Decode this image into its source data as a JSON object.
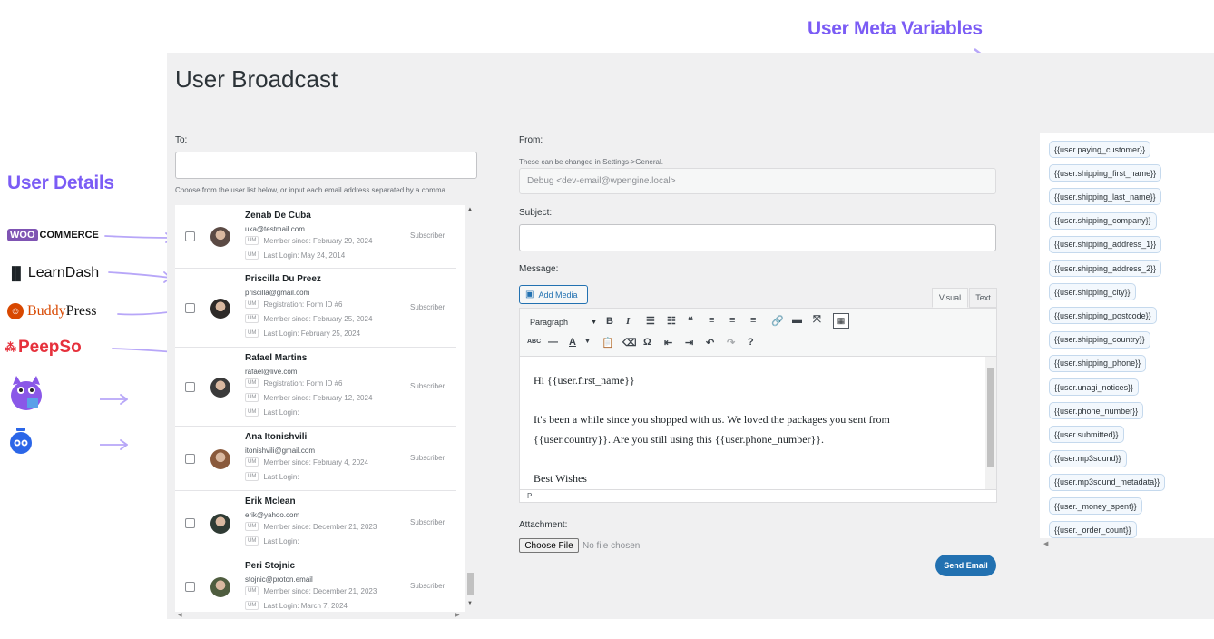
{
  "callouts": {
    "user_details": "User Details",
    "user_meta_variables": "User Meta Variables"
  },
  "integrations": [
    {
      "name": "woocommerce",
      "label": "COMMERCE",
      "badge": "WOO"
    },
    {
      "name": "learndash",
      "label": "LearnDash"
    },
    {
      "name": "buddypress",
      "label": "BuddyPress",
      "prefix": "Buddy",
      "suffix": "Press"
    },
    {
      "name": "peepso",
      "label": "PeepSo"
    },
    {
      "name": "mascot",
      "label": ""
    },
    {
      "name": "clock-logo",
      "label": ""
    }
  ],
  "page": {
    "title": "User Broadcast"
  },
  "to": {
    "label": "To:",
    "value": "",
    "help": "Choose from the user list below, or input each email address separated by a comma."
  },
  "users": [
    {
      "name": "Zenab De Cuba",
      "email": "uka@testmail.com",
      "meta": [
        "Member since: February 29, 2024",
        "Last Login: May 24, 2014"
      ],
      "role": "Subscriber",
      "avatar_color": "#5b4a44"
    },
    {
      "name": "Priscilla Du Preez",
      "email": "priscilla@gmail.com",
      "meta": [
        "Registration: Form ID #6",
        "Member since: February 25, 2024",
        "Last Login: February 25, 2024"
      ],
      "role": "Subscriber",
      "avatar_color": "#2e2a28"
    },
    {
      "name": "Rafael Martins",
      "email": "rafael@live.com",
      "meta": [
        "Registration: Form ID #6",
        "Member since: February 12, 2024",
        "Last Login:"
      ],
      "role": "Subscriber",
      "avatar_color": "#3a3a3a"
    },
    {
      "name": "Ana Itonishvili",
      "email": "itonishvili@gmail.com",
      "meta": [
        "Member since: February 4, 2024",
        "Last Login:"
      ],
      "role": "Subscriber",
      "avatar_color": "#8a5a3c"
    },
    {
      "name": "Erik Mclean",
      "email": "erik@yahoo.com",
      "meta": [
        "Member since: December 21, 2023",
        "Last Login:"
      ],
      "role": "Subscriber",
      "avatar_color": "#2f3b34"
    },
    {
      "name": "Peri Stojnic",
      "email": "stojnic@proton.email",
      "meta": [
        "Member since: December 21, 2023",
        "Last Login: March 7, 2024"
      ],
      "role": "Subscriber",
      "avatar_color": "#4f5d3f"
    }
  ],
  "um_badge": "UM",
  "from": {
    "label": "From:",
    "help": "These can be changed in Settings->General.",
    "value": "Debug <dev-email@wpengine.local>"
  },
  "subject": {
    "label": "Subject:",
    "value": ""
  },
  "message": {
    "label": "Message:",
    "add_media": "Add Media",
    "tabs": [
      "Visual",
      "Text"
    ],
    "format_select": "Paragraph",
    "body": [
      "Hi {{user.first_name}}",
      "It's been a while since you shopped with us. We loved the packages you sent from",
      "{{user.country}}. Are you still using this {{user.phone_number}}.",
      "Best Wishes"
    ],
    "status_path": "P"
  },
  "attachment": {
    "label": "Attachment:",
    "button": "Choose File",
    "status": "No file chosen"
  },
  "send_button": "Send Email",
  "meta_variables": [
    "{{user.paying_customer}}",
    "{{user.shipping_first_name}}",
    "{{user.shipping_last_name}}",
    "{{user.shipping_company}}",
    "{{user.shipping_address_1}}",
    "{{user.shipping_address_2}}",
    "{{user.shipping_city}}",
    "{{user.shipping_postcode}}",
    "{{user.shipping_country}}",
    "{{user.shipping_phone}}",
    "{{user.unagi_notices}}",
    "{{user.phone_number}}",
    "{{user.submitted}}",
    "{{user.mp3sound}}",
    "{{user.mp3sound_metadata}}",
    "{{user._money_spent}}",
    "{{user._order_count}}"
  ],
  "colors": {
    "accent": "#7b5cf5",
    "primary": "#2271b1",
    "panel": "#f0f0f1"
  }
}
